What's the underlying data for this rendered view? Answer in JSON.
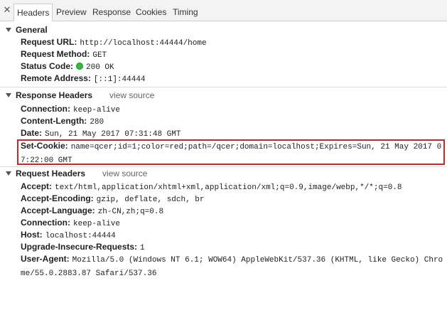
{
  "tabs": {
    "close_symbol": "✕",
    "items": [
      {
        "label": "Headers"
      },
      {
        "label": "Preview"
      },
      {
        "label": "Response"
      },
      {
        "label": "Cookies"
      },
      {
        "label": "Timing"
      }
    ],
    "active": "Headers"
  },
  "general": {
    "title": "General",
    "rows": [
      {
        "key": "Request URL:",
        "value": "http://localhost:44444/home"
      },
      {
        "key": "Request Method:",
        "value": "GET"
      },
      {
        "key": "Status Code:",
        "value": "200 OK"
      },
      {
        "key": "Remote Address:",
        "value": "[::1]:44444"
      }
    ],
    "status_color": "#2dbf3a"
  },
  "response_headers": {
    "title": "Response Headers",
    "view_source": "view source",
    "rows": [
      {
        "key": "Connection:",
        "value": "keep-alive"
      },
      {
        "key": "Content-Length:",
        "value": "280"
      },
      {
        "key": "Date:",
        "value": "Sun, 21 May 2017 07:31:48 GMT"
      },
      {
        "key": "Set-Cookie:",
        "value": "name=qcer;id=1;color=red;path=/qcer;domain=localhost;Expires=Sun, 21 May 2017 07:22:00 GMT"
      }
    ],
    "highlight_color": "#c62828"
  },
  "request_headers": {
    "title": "Request Headers",
    "view_source": "view source",
    "rows": [
      {
        "key": "Accept:",
        "value": "text/html,application/xhtml+xml,application/xml;q=0.9,image/webp,*/*;q=0.8"
      },
      {
        "key": "Accept-Encoding:",
        "value": "gzip, deflate, sdch, br"
      },
      {
        "key": "Accept-Language:",
        "value": "zh-CN,zh;q=0.8"
      },
      {
        "key": "Connection:",
        "value": "keep-alive"
      },
      {
        "key": "Host:",
        "value": "localhost:44444"
      },
      {
        "key": "Upgrade-Insecure-Requests:",
        "value": "1"
      },
      {
        "key": "User-Agent:",
        "value": "Mozilla/5.0 (Windows NT 6.1; WOW64) AppleWebKit/537.36 (KHTML, like Gecko) Chrome/55.0.2883.87 Safari/537.36"
      }
    ]
  }
}
